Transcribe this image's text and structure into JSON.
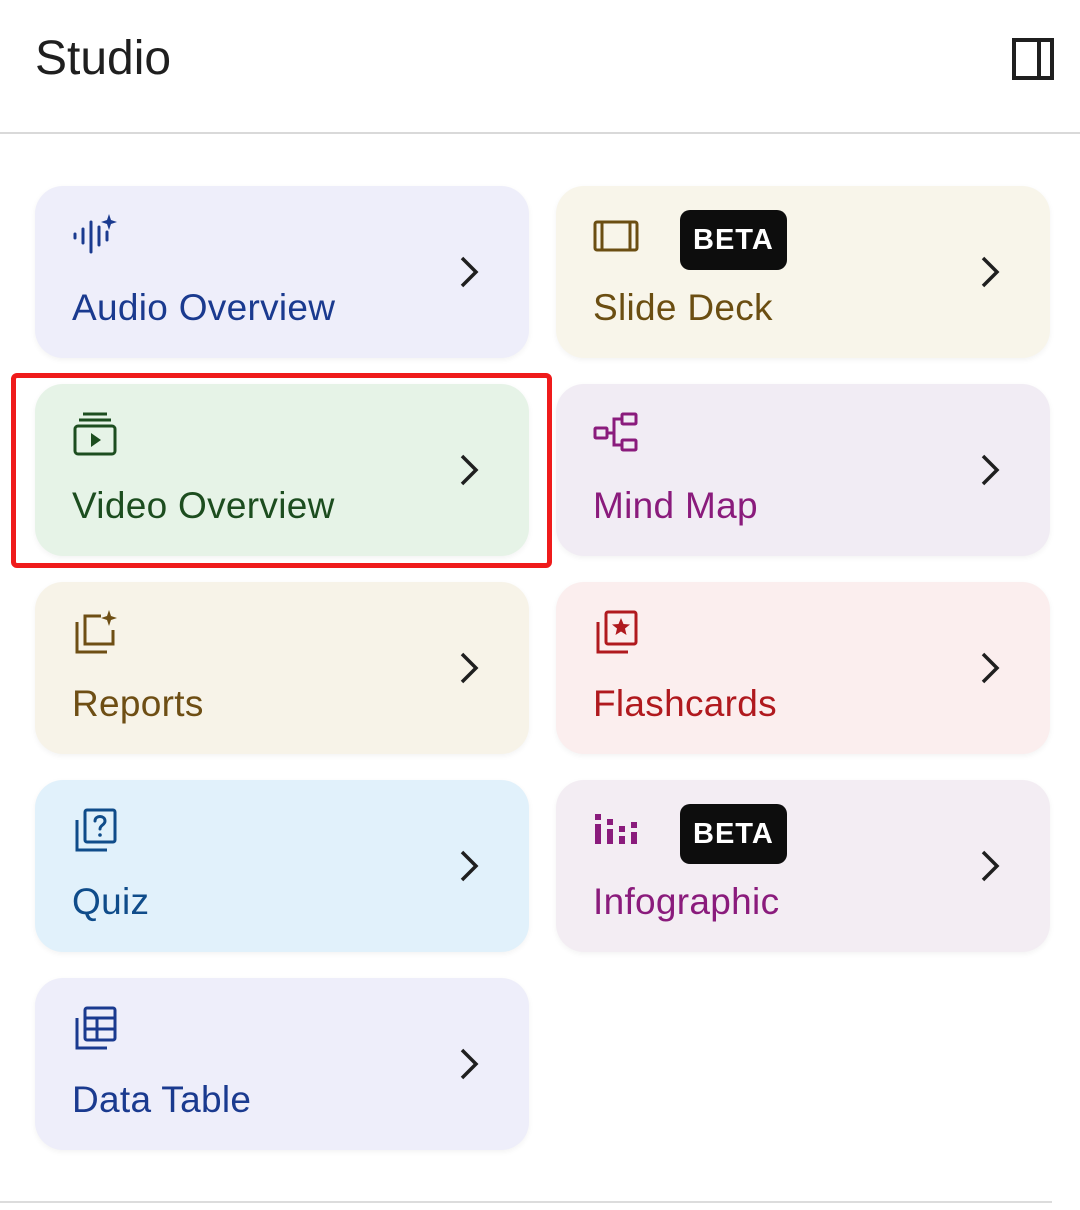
{
  "header": {
    "title": "Studio",
    "panel_toggle_icon": "side-panel-icon"
  },
  "cards": [
    {
      "label": "Audio Overview",
      "icon": "audio-sparkle-icon",
      "bg": "#eeeefa",
      "fg": "#1a3a8f"
    },
    {
      "label": "Slide Deck",
      "icon": "slide-icon",
      "badge": "BETA",
      "bg": "#f8f5ea",
      "fg": "#6b4e12"
    },
    {
      "label": "Video Overview",
      "icon": "video-stack-icon",
      "bg": "#e6f3e7",
      "fg": "#1c4d1f"
    },
    {
      "label": "Mind Map",
      "icon": "mind-map-icon",
      "bg": "#f1ecf4",
      "fg": "#8a1b7c"
    },
    {
      "label": "Reports",
      "icon": "reports-sparkle-icon",
      "bg": "#f7f3e8",
      "fg": "#6e4e14"
    },
    {
      "label": "Flashcards",
      "icon": "flashcards-icon",
      "bg": "#fbeeee",
      "fg": "#b0191e"
    },
    {
      "label": "Quiz",
      "icon": "quiz-icon",
      "bg": "#e1f1fb",
      "fg": "#0f4c8a"
    },
    {
      "label": "Infographic",
      "icon": "infographic-icon",
      "badge": "BETA",
      "bg": "#f3edf3",
      "fg": "#8a1b7c"
    },
    {
      "label": "Data Table",
      "icon": "data-table-icon",
      "bg": "#eeeefa",
      "fg": "#1a3a8f"
    }
  ],
  "highlight_color": "#ef1b1b"
}
